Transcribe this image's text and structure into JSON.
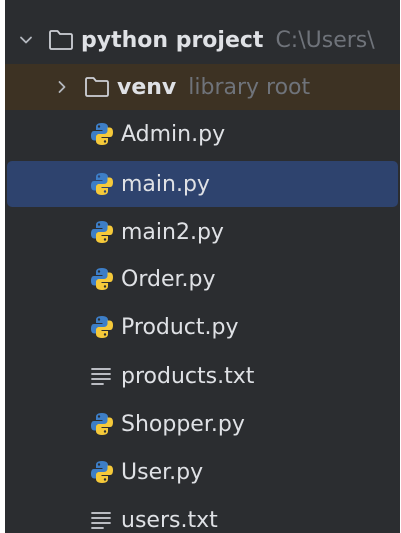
{
  "project_tree": {
    "root": {
      "name": "python project",
      "path_hint": "C:\\Users\\",
      "expanded": true,
      "icon": "folder-icon"
    },
    "venv": {
      "name": "venv",
      "hint": "library root",
      "expanded": false,
      "icon": "folder-icon"
    },
    "files": [
      {
        "name": "Admin.py",
        "icon": "python-file-icon"
      },
      {
        "name": "main.py",
        "icon": "python-file-icon",
        "selected": true
      },
      {
        "name": "main2.py",
        "icon": "python-file-icon"
      },
      {
        "name": "Order.py",
        "icon": "python-file-icon"
      },
      {
        "name": "Product.py",
        "icon": "python-file-icon"
      },
      {
        "name": "products.txt",
        "icon": "text-file-icon"
      },
      {
        "name": "Shopper.py",
        "icon": "python-file-icon"
      },
      {
        "name": "User.py",
        "icon": "python-file-icon"
      },
      {
        "name": "users.txt",
        "icon": "text-file-icon"
      }
    ]
  },
  "colors": {
    "panel_bg": "#2b2d30",
    "selected_bg": "#2e436e",
    "excluded_bg": "#3d3223",
    "text": "#dfe1e5",
    "hint_text": "#6f737a",
    "python_blue": "#3d7ec7",
    "python_yellow": "#f5c93a"
  }
}
